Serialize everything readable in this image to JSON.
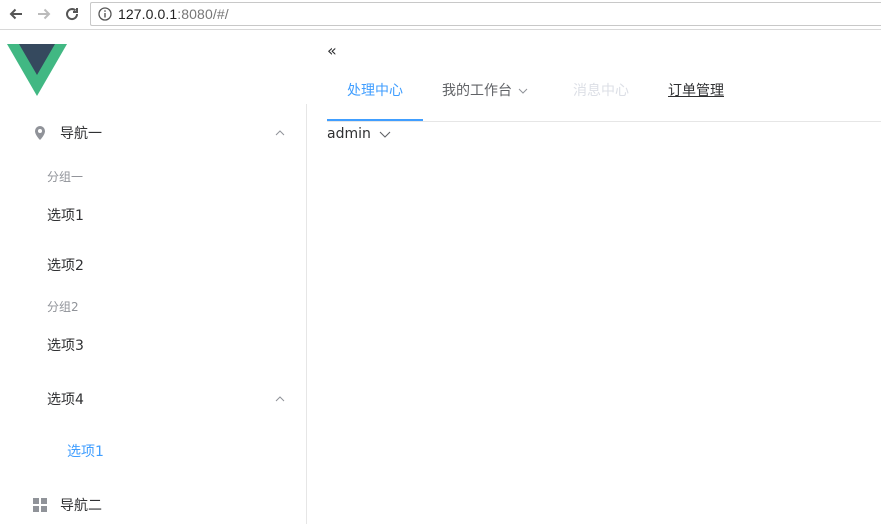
{
  "browser": {
    "url_host": "127.0.0.1",
    "url_rest": ":8080/#/"
  },
  "header": {
    "collapse_icon": "«",
    "tabs": [
      {
        "label": "处理中心",
        "state": "active"
      },
      {
        "label": "我的工作台",
        "state": "dropdown"
      },
      {
        "label": "消息中心",
        "state": "disabled"
      },
      {
        "label": "订单管理",
        "state": "link"
      }
    ],
    "user": "admin"
  },
  "sidebar": {
    "nav1": {
      "label": "导航一",
      "icon": "location-icon"
    },
    "group1": "分组一",
    "item1": "选项1",
    "item2": "选项2",
    "group2": "分组2",
    "item3": "选项3",
    "item4": "选项4",
    "sub_item1": "选项1",
    "nav2": {
      "label": "导航二",
      "icon": "grid-icon"
    }
  },
  "colors": {
    "accent": "#409eff",
    "logo_green": "#41b883",
    "logo_dark": "#35495e"
  }
}
